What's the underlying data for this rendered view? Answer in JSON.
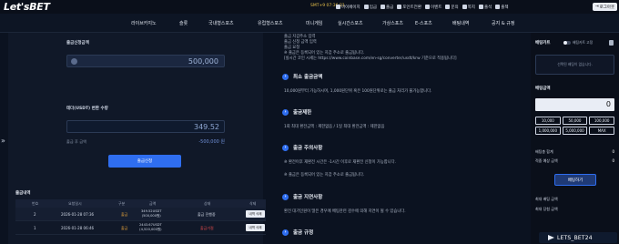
{
  "header": {
    "logo": "Let'sBET",
    "clock": "SMT+9 07:36:21",
    "icons": [
      {
        "label": "마이페이지",
        "icon": "user-icon"
      },
      {
        "label": "입금",
        "icon": "deposit-icon"
      },
      {
        "label": "출금",
        "icon": "withdraw-icon"
      },
      {
        "label": "포인트전환",
        "icon": "point-icon"
      },
      {
        "label": "이벤트",
        "icon": "gift-icon"
      },
      {
        "label": "문의",
        "icon": "question-icon"
      },
      {
        "label": "쪽지",
        "icon": "mail-icon"
      },
      {
        "label": "출석",
        "icon": "calendar-icon"
      },
      {
        "label": "출첵",
        "icon": "check-icon"
      }
    ],
    "logout": "로그아웃"
  },
  "nav": [
    "라이브카지노",
    "슬롯",
    "국내형스포츠",
    "유럽형스포츠",
    "미니게임",
    "실시간스포츠",
    "가상스포츠",
    "E-스포츠",
    "배팅내역",
    "공지 & 규정"
  ],
  "withdraw": {
    "amount_label": "출금신청금액",
    "amount_value": "500,000",
    "usdt_label": "테더(USDT) 변환 수량",
    "usdt_value": "349.52",
    "fee_label": "출금 후 금액",
    "fee_value": "-500,000 원",
    "apply_btn": "출금신청"
  },
  "history": {
    "title": "출금내역",
    "columns": [
      "번호",
      "요청일시",
      "구분",
      "금액",
      "상태",
      "삭제"
    ],
    "rows": [
      {
        "no": "2",
        "date": "2026-01-28 07:36",
        "type": "출금",
        "amt1": "349.52USDT",
        "amt2": "(500,000원)",
        "status": "출금 진행중",
        "status_color": "#e2e7f0",
        "btn": "내역 삭제"
      },
      {
        "no": "1",
        "date": "2026-01-28 06:46",
        "type": "출금",
        "amt1": "2443.67USDT",
        "amt2": "(4,520,000원)",
        "status": "출금거절",
        "status_color": "#e24b4b",
        "btn": "내역 삭제"
      }
    ],
    "pager": {
      "first": "«",
      "prev": "‹",
      "current": "1",
      "next": "›",
      "last": "»"
    }
  },
  "info": {
    "top_lines": [
      "출금 지갑주소 입력",
      "출금 신청 금액 입력",
      "출금 요청",
      "※ 출금은 등록되어 있는 지갑 주소로 출금됩니다.",
      "[실시간 코인 시세는 https://www.coinbase.com/en-sg/converter/usdt/krw 기준으로 적용됩니다]"
    ],
    "sections": [
      {
        "title": "최소 출금금액",
        "lines": [
          "10,000원부터 가능하시며, 1,000원단위 혹은 100원단위로는 출금 처리가 불가능합니다."
        ]
      },
      {
        "title": "출금제한",
        "lines": [
          "1회 최대 환전금액 : 제한없음 / 1일 최대 환전금액 : 제한없음"
        ]
      },
      {
        "title": "출금 주의사항",
        "lines": [
          "※ 환전이후 재환전 시간은 -1시간 이후로 재환전 신청이 가능합니다.",
          "※ 출금은 등록되어 있는 지갑 주소로 출금됩니다."
        ]
      },
      {
        "title": "출금 지연사항",
        "lines": [
          "환전 대기인원이 많은 경우에 배팅관련 검수에 의해 지연이 될 수 있습니다."
        ]
      },
      {
        "title": "출금 규정",
        "lines": []
      }
    ]
  },
  "betslip": {
    "title": "배팅카트",
    "toggle_label": "배팅카트 고정",
    "empty_text": "선택된 배팅이 없습니다.",
    "amount_title": "배팅금액",
    "amount_value": "0",
    "chips": [
      "10,000",
      "50,000",
      "100,000",
      "1,000,000",
      "5,000,000",
      "MAX"
    ],
    "summary": [
      {
        "k": "배팅총 합계",
        "v": "0"
      },
      {
        "k": "적중 예상 금액",
        "v": "0"
      }
    ],
    "bet_btn": "배팅하기",
    "limits": [
      "최대 배팅 금액",
      "최대 당첨 금액"
    ]
  },
  "telegram": "LETS_BET24"
}
